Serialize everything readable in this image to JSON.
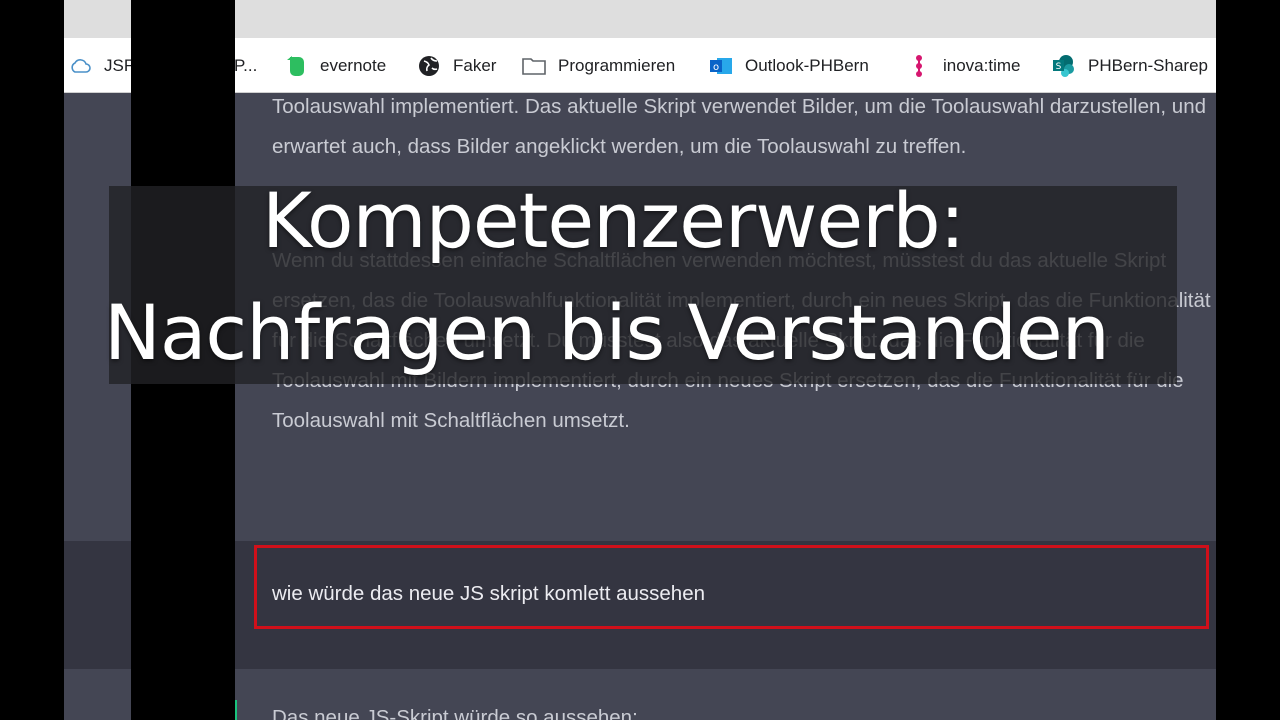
{
  "bookmarks": [
    {
      "label": "JSFi",
      "icon": "cloud-icon"
    },
    {
      "label": "P...",
      "icon": ""
    },
    {
      "label": "evernote",
      "icon": "evernote-icon"
    },
    {
      "label": "Faker",
      "icon": "globe-icon"
    },
    {
      "label": "Programmieren",
      "icon": "folder-icon"
    },
    {
      "label": "Outlook-PHBern",
      "icon": "outlook-icon"
    },
    {
      "label": "inova:time",
      "icon": "inova-icon"
    },
    {
      "label": "PHBern-Sharep",
      "icon": "sharepoint-icon"
    }
  ],
  "chat": {
    "assistant_para1": "Toolauswahl implementiert. Das aktuelle Skript verwendet Bilder, um die Toolauswahl darzustellen, und erwartet auch, dass Bilder angeklickt werden, um die Toolauswahl zu treffen.",
    "assistant_para2": "Wenn du stattdessen einfache Schaltflächen verwenden möchtest, müsstest du das aktuelle Skript ersetzen, das die Toolauswahlfunktionalität implementiert, durch ein neues Skript, das die Funktionalität für die Schaltflächen umsetzt. Du müsstest also das aktuelle Skript, das die Funktionalität für die Toolauswahl mit Bildern implementiert, durch ein neues Skript ersetzen, das die Funktionalität für die Toolauswahl mit Schaltflächen umsetzt.",
    "user_message": "wie würde das neue JS skript komlett aussehen",
    "assistant_reply_start": "Das neue JS-Skript würde so aussehen:"
  },
  "overlay": {
    "line1": "Kompetenzerwerb:",
    "line2": "Nachfragen bis Verstanden"
  },
  "colors": {
    "highlight_border": "#d0101a",
    "evernote": "#2dbe60",
    "outlook": "#0a64c8",
    "inova": "#d6166f",
    "sharepoint": "#038387"
  }
}
